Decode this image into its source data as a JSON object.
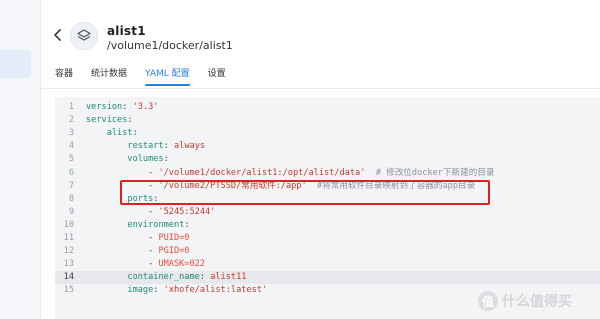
{
  "header": {
    "title": "alist1",
    "subtitle": "/volume1/docker/alist1"
  },
  "icons": {
    "back": "chevron-left-icon",
    "app": "layers-icon"
  },
  "tabs": [
    {
      "label": "容器",
      "active": false
    },
    {
      "label": "统计数据",
      "active": false
    },
    {
      "label": "YAML 配置",
      "active": true
    },
    {
      "label": "设置",
      "active": false
    }
  ],
  "editor": {
    "current_line": 14,
    "lines": [
      {
        "num": "1",
        "tokens": [
          {
            "t": "k",
            "v": "version"
          },
          {
            "t": "p",
            "v": ": "
          },
          {
            "t": "s",
            "v": "'3.3'"
          }
        ]
      },
      {
        "num": "2",
        "tokens": [
          {
            "t": "k",
            "v": "services"
          },
          {
            "t": "p",
            "v": ":"
          }
        ]
      },
      {
        "num": "3",
        "tokens": [
          {
            "t": "p",
            "v": "    "
          },
          {
            "t": "k",
            "v": "alist"
          },
          {
            "t": "p",
            "v": ":"
          }
        ]
      },
      {
        "num": "4",
        "tokens": [
          {
            "t": "p",
            "v": "        "
          },
          {
            "t": "k",
            "v": "restart"
          },
          {
            "t": "p",
            "v": ": "
          },
          {
            "t": "s",
            "v": "always"
          }
        ]
      },
      {
        "num": "5",
        "tokens": [
          {
            "t": "p",
            "v": "        "
          },
          {
            "t": "k",
            "v": "volumes"
          },
          {
            "t": "p",
            "v": ":"
          }
        ]
      },
      {
        "num": "6",
        "tokens": [
          {
            "t": "p",
            "v": "            - "
          },
          {
            "t": "s",
            "v": "'/volume1/docker/alist1:/opt/alist/data'"
          },
          {
            "t": "p",
            "v": "  "
          },
          {
            "t": "c",
            "v": "# 修改位docker下新建的目录"
          }
        ]
      },
      {
        "num": "7",
        "tokens": [
          {
            "t": "p",
            "v": "            - "
          },
          {
            "t": "s",
            "v": "'/volume2/PTSSD/常用软件:/app'"
          },
          {
            "t": "p",
            "v": "  "
          },
          {
            "t": "c",
            "v": "#将常用软件目录映射到了容器的app目录"
          }
        ]
      },
      {
        "num": "8",
        "tokens": [
          {
            "t": "p",
            "v": "        "
          },
          {
            "t": "k",
            "v": "ports"
          },
          {
            "t": "p",
            "v": ":"
          }
        ]
      },
      {
        "num": "9",
        "tokens": [
          {
            "t": "p",
            "v": "            - "
          },
          {
            "t": "s",
            "v": "'5245:5244'"
          }
        ]
      },
      {
        "num": "10",
        "tokens": [
          {
            "t": "p",
            "v": "        "
          },
          {
            "t": "k",
            "v": "environment"
          },
          {
            "t": "p",
            "v": ":"
          }
        ]
      },
      {
        "num": "11",
        "tokens": [
          {
            "t": "p",
            "v": "            - "
          },
          {
            "t": "n",
            "v": "PUID=0"
          }
        ]
      },
      {
        "num": "12",
        "tokens": [
          {
            "t": "p",
            "v": "            - "
          },
          {
            "t": "n",
            "v": "PGID=0"
          }
        ]
      },
      {
        "num": "13",
        "tokens": [
          {
            "t": "p",
            "v": "            - "
          },
          {
            "t": "n",
            "v": "UMASK=022"
          }
        ]
      },
      {
        "num": "14",
        "tokens": [
          {
            "t": "p",
            "v": "        "
          },
          {
            "t": "k",
            "v": "container_name"
          },
          {
            "t": "p",
            "v": ": "
          },
          {
            "t": "s",
            "v": "alist11"
          }
        ]
      },
      {
        "num": "15",
        "tokens": [
          {
            "t": "p",
            "v": "        "
          },
          {
            "t": "k",
            "v": "image"
          },
          {
            "t": "p",
            "v": ": "
          },
          {
            "t": "s",
            "v": "'xhofe/alist:latest'"
          }
        ]
      }
    ]
  },
  "colors": {
    "accent": "#2b7de1",
    "annotation_box": "#e02020",
    "yaml_key": "#1f8a70",
    "yaml_string": "#c0392b",
    "yaml_comment": "#8c9299"
  },
  "watermark": {
    "badge": "值",
    "text": "什么值得买"
  }
}
